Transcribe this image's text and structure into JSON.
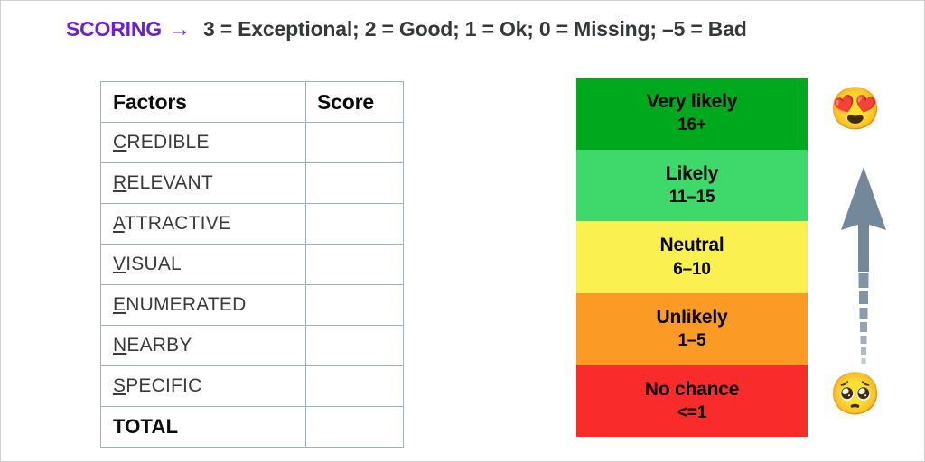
{
  "header": {
    "label": "SCORING",
    "arrow": "→",
    "legend": "3 = Exceptional; 2 = Good; 1 = Ok; 0 = Missing; –5 = Bad",
    "label_color": "#6A20D8",
    "legend_color": "#35373B"
  },
  "table": {
    "columns": [
      "Factors",
      "Score"
    ],
    "border_color": "#9FB0BE",
    "rows": [
      {
        "initial": "C",
        "rest": "REDIBLE",
        "score": ""
      },
      {
        "initial": "R",
        "rest": "ELEVANT",
        "score": ""
      },
      {
        "initial": "A",
        "rest": "TTRACTIVE",
        "score": ""
      },
      {
        "initial": "V",
        "rest": "ISUAL",
        "score": ""
      },
      {
        "initial": "E",
        "rest": "NUMERATED",
        "score": ""
      },
      {
        "initial": "N",
        "rest": "EARBY",
        "score": ""
      },
      {
        "initial": "S",
        "rest": "PECIFIC",
        "score": ""
      }
    ],
    "total_row": {
      "label": "TOTAL",
      "score": ""
    }
  },
  "scale": {
    "bands": [
      {
        "label": "Very likely",
        "range": "16+",
        "color": "#00A81E"
      },
      {
        "label": "Likely",
        "range": "11–15",
        "color": "#3ED96A"
      },
      {
        "label": "Neutral",
        "range": "6–10",
        "color": "#FAF050"
      },
      {
        "label": "Unlikely",
        "range": "1–5",
        "color": "#FC9A26"
      },
      {
        "label": "No chance",
        "range": "<=1",
        "color": "#FA2B2B"
      }
    ]
  },
  "rail": {
    "top_emoji": "😍",
    "top_emoji_name": "heart-eyes-emoji",
    "bottom_emoji": "🥺",
    "bottom_emoji_name": "pleading-face-emoji",
    "arrow_color": "#73889B"
  }
}
